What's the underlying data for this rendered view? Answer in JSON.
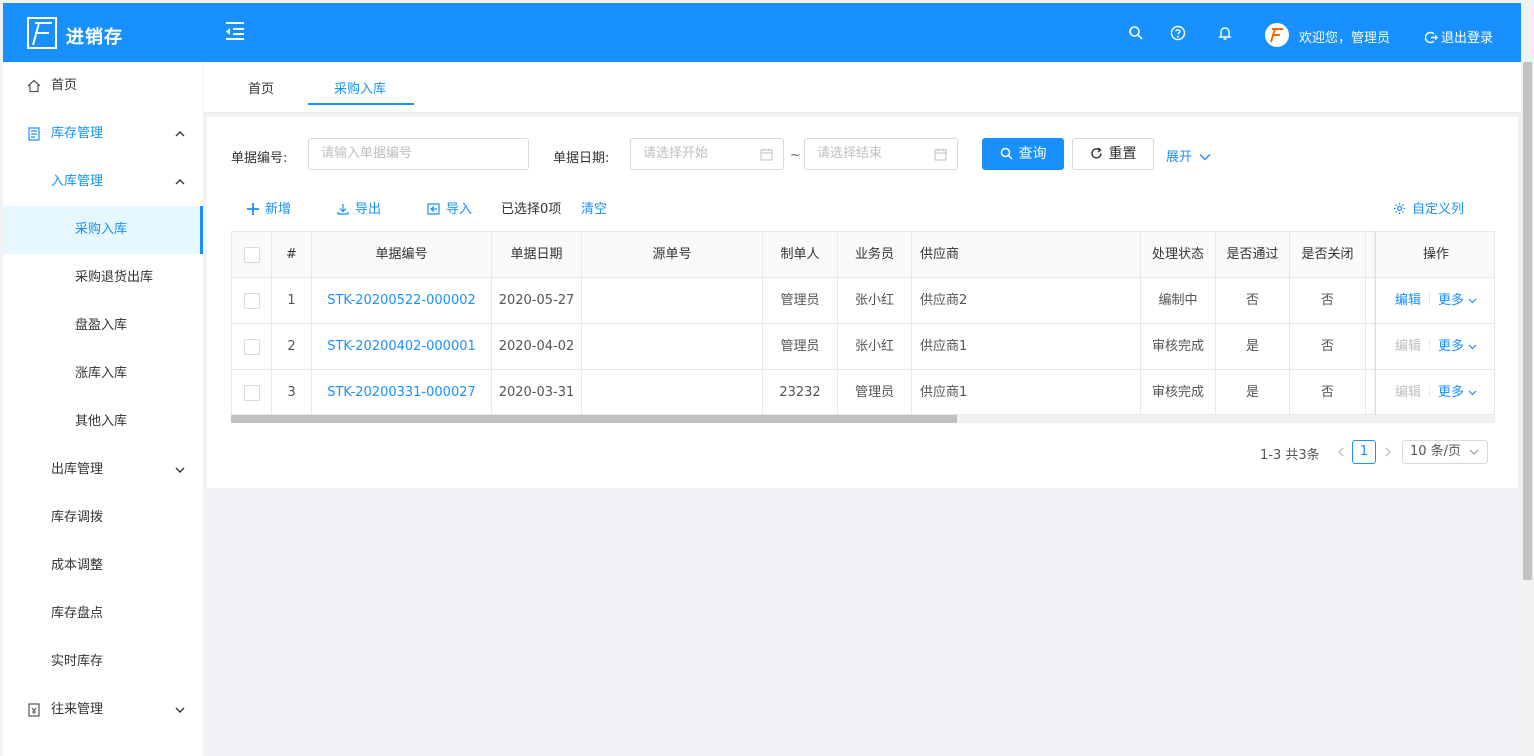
{
  "app": {
    "title": "进销存"
  },
  "header": {
    "welcome": "欢迎您，管理员",
    "logout": "退出登录"
  },
  "sidebar": {
    "items": [
      {
        "label": "首页",
        "icon": "home-icon"
      },
      {
        "label": "库存管理",
        "icon": "inventory-icon",
        "expanded": true
      },
      {
        "label": "入库管理",
        "expanded": true
      },
      {
        "label": "采购入库",
        "selected": true
      },
      {
        "label": "采购退货出库"
      },
      {
        "label": "盘盈入库"
      },
      {
        "label": "涨库入库"
      },
      {
        "label": "其他入库"
      },
      {
        "label": "出库管理",
        "expanded": false
      },
      {
        "label": "库存调拨"
      },
      {
        "label": "成本调整"
      },
      {
        "label": "库存盘点"
      },
      {
        "label": "实时库存"
      },
      {
        "label": "往来管理",
        "icon": "ledger-icon",
        "expanded": false
      }
    ]
  },
  "tabs": [
    {
      "label": "首页"
    },
    {
      "label": "采购入库",
      "active": true
    }
  ],
  "filters": {
    "bill_no_label": "单据编号:",
    "bill_no_placeholder": "请输入单据编号",
    "bill_date_label": "单据日期:",
    "start_placeholder": "请选择开始",
    "range_sep": "~",
    "end_placeholder": "请选择结束",
    "search_label": "查询",
    "reset_label": "重置",
    "expand_label": "展开"
  },
  "toolbar": {
    "add_label": "新增",
    "export_label": "导出",
    "import_label": "导入",
    "selected_text": "已选择0项",
    "clear_label": "清空",
    "custom_columns_label": "自定义列"
  },
  "table": {
    "columns": [
      "#",
      "单据编号",
      "单据日期",
      "源单号",
      "制单人",
      "业务员",
      "供应商",
      "处理状态",
      "是否通过",
      "是否关闭",
      "操作"
    ],
    "rows": [
      {
        "index": "1",
        "bill_no": "STK-20200522-000002",
        "date": "2020-05-27",
        "source_no": "",
        "maker": "管理员",
        "salesman": "张小红",
        "supplier": "供应商2",
        "status": "编制中",
        "approved": "否",
        "closed": "否",
        "edit": "编辑",
        "edit_enabled": true,
        "more": "更多"
      },
      {
        "index": "2",
        "bill_no": "STK-20200402-000001",
        "date": "2020-04-02",
        "source_no": "",
        "maker": "管理员",
        "salesman": "张小红",
        "supplier": "供应商1",
        "status": "审核完成",
        "approved": "是",
        "closed": "否",
        "edit": "编辑",
        "edit_enabled": false,
        "more": "更多"
      },
      {
        "index": "3",
        "bill_no": "STK-20200331-000027",
        "date": "2020-03-31",
        "source_no": "",
        "maker": "23232",
        "salesman": "管理员",
        "supplier": "供应商1",
        "status": "审核完成",
        "approved": "是",
        "closed": "否",
        "edit": "编辑",
        "edit_enabled": false,
        "more": "更多"
      }
    ]
  },
  "pagination": {
    "total_text": "1-3 共3条",
    "current_page": "1",
    "page_size": "10 条/页"
  },
  "colors": {
    "primary": "#1890ff",
    "selected_bg": "#e6f7ff",
    "disabled": "#bfbfbf"
  }
}
